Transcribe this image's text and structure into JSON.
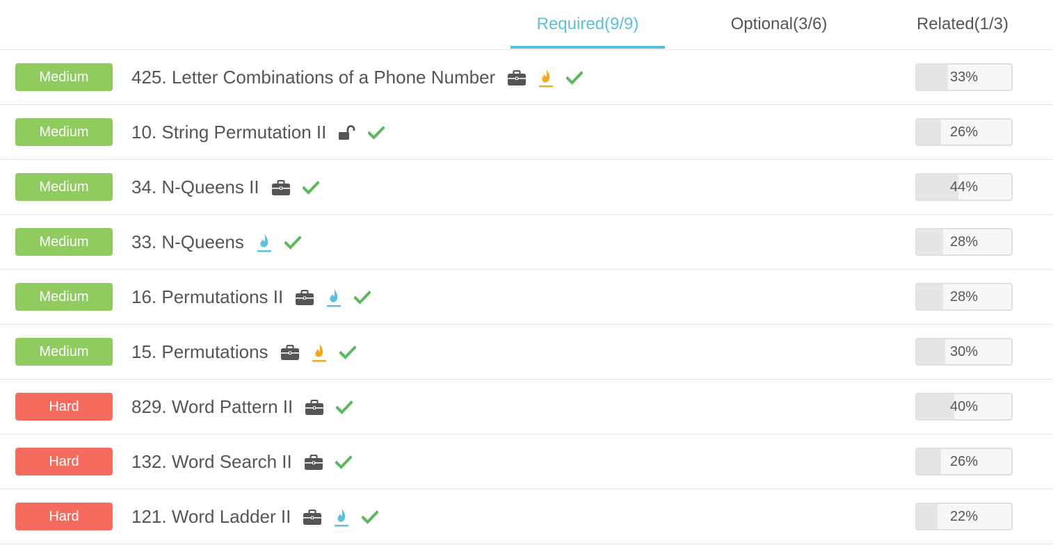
{
  "tabs": {
    "required": "Required(9/9)",
    "optional": "Optional(3/6)",
    "related": "Related(1/3)"
  },
  "colors": {
    "accent": "#5bc0de",
    "medium": "#8fcb5f",
    "hard": "#f56c5f",
    "check": "#5cb85c",
    "flame_orange": "#f5a623",
    "flame_blue": "#5bc0de",
    "icon_dark": "#555555"
  },
  "problems": [
    {
      "difficulty": "Medium",
      "title": "425. Letter Combinations of a Phone Number",
      "icons": [
        "briefcase-icon",
        "flame-orange-icon",
        "check-icon"
      ],
      "acceptance": "33%",
      "acceptance_value": 33
    },
    {
      "difficulty": "Medium",
      "title": "10. String Permutation II",
      "icons": [
        "unlock-icon",
        "check-icon"
      ],
      "acceptance": "26%",
      "acceptance_value": 26
    },
    {
      "difficulty": "Medium",
      "title": "34. N-Queens II",
      "icons": [
        "briefcase-icon",
        "check-icon"
      ],
      "acceptance": "44%",
      "acceptance_value": 44
    },
    {
      "difficulty": "Medium",
      "title": "33. N-Queens",
      "icons": [
        "flame-blue-icon",
        "check-icon"
      ],
      "acceptance": "28%",
      "acceptance_value": 28
    },
    {
      "difficulty": "Medium",
      "title": "16. Permutations II",
      "icons": [
        "briefcase-icon",
        "flame-blue-icon",
        "check-icon"
      ],
      "acceptance": "28%",
      "acceptance_value": 28
    },
    {
      "difficulty": "Medium",
      "title": "15. Permutations",
      "icons": [
        "briefcase-icon",
        "flame-orange-icon",
        "check-icon"
      ],
      "acceptance": "30%",
      "acceptance_value": 30
    },
    {
      "difficulty": "Hard",
      "title": "829. Word Pattern II",
      "icons": [
        "briefcase-icon",
        "check-icon"
      ],
      "acceptance": "40%",
      "acceptance_value": 40
    },
    {
      "difficulty": "Hard",
      "title": "132. Word Search II",
      "icons": [
        "briefcase-icon",
        "check-icon"
      ],
      "acceptance": "26%",
      "acceptance_value": 26
    },
    {
      "difficulty": "Hard",
      "title": "121. Word Ladder II",
      "icons": [
        "briefcase-icon",
        "flame-blue-icon",
        "check-icon"
      ],
      "acceptance": "22%",
      "acceptance_value": 22
    }
  ]
}
